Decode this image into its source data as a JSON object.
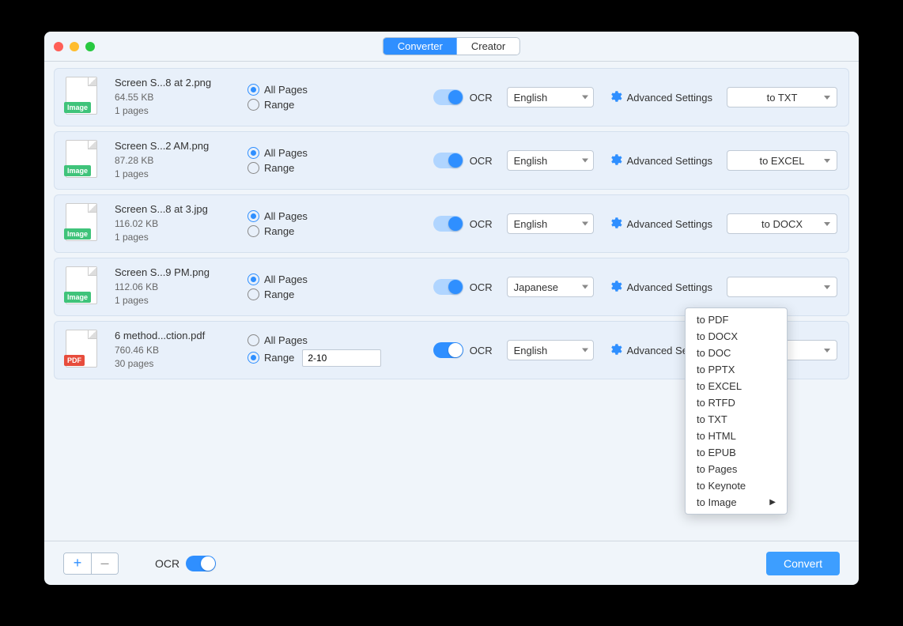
{
  "titlebar": {
    "tabs": {
      "converter": "Converter",
      "creator": "Creator"
    }
  },
  "labels": {
    "all_pages": "All Pages",
    "range": "Range",
    "ocr": "OCR",
    "advanced": "Advanced Settings",
    "footer_ocr": "OCR",
    "convert": "Convert",
    "add": "+",
    "remove": "–"
  },
  "files": [
    {
      "name": "Screen S...8 at 2.png",
      "size": "64.55 KB",
      "pages": "1 pages",
      "type": "Image",
      "page_mode": "all",
      "range_value": "",
      "ocr_on": true,
      "ocr_style": "light",
      "lang": "English",
      "format": "to TXT"
    },
    {
      "name": "Screen S...2 AM.png",
      "size": "87.28 KB",
      "pages": "1 pages",
      "type": "Image",
      "page_mode": "all",
      "range_value": "",
      "ocr_on": true,
      "ocr_style": "light",
      "lang": "English",
      "format": "to EXCEL"
    },
    {
      "name": "Screen S...8 at 3.jpg",
      "size": "116.02 KB",
      "pages": "1 pages",
      "type": "Image",
      "page_mode": "all",
      "range_value": "",
      "ocr_on": true,
      "ocr_style": "light",
      "lang": "English",
      "format": "to DOCX"
    },
    {
      "name": "Screen S...9 PM.png",
      "size": "112.06 KB",
      "pages": "1 pages",
      "type": "Image",
      "page_mode": "all",
      "range_value": "",
      "ocr_on": true,
      "ocr_style": "light",
      "lang": "Japanese",
      "format": ""
    },
    {
      "name": "6 method...ction.pdf",
      "size": "760.46 KB",
      "pages": "30 pages",
      "type": "PDF",
      "page_mode": "range",
      "range_value": "2-10",
      "ocr_on": true,
      "ocr_style": "solid",
      "lang": "English",
      "format": ""
    }
  ],
  "dropdown": {
    "items": [
      "to PDF",
      "to DOCX",
      "to DOC",
      "to PPTX",
      "to EXCEL",
      "to RTFD",
      "to TXT",
      "to HTML",
      "to EPUB",
      "to Pages",
      "to Keynote",
      "to Image"
    ],
    "submenu_on": "to Image"
  }
}
